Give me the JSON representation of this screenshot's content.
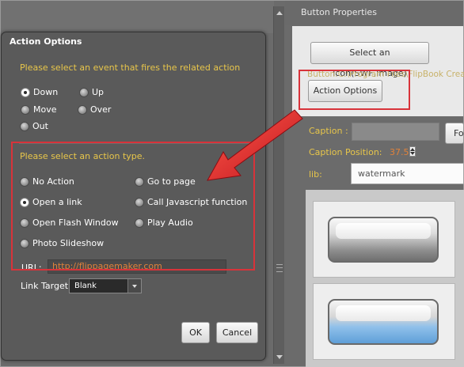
{
  "dialog": {
    "title": "Action Options",
    "event_prompt": "Please select an event that fires the related action",
    "events": [
      {
        "label": "Down",
        "checked": true
      },
      {
        "label": "Up",
        "checked": false
      },
      {
        "label": "Move",
        "checked": false
      },
      {
        "label": "Over",
        "checked": false
      },
      {
        "label": "Out",
        "checked": false
      }
    ],
    "action_prompt": "Please select an action type.",
    "actions": [
      {
        "label": "No Action",
        "checked": false
      },
      {
        "label": "Go to page",
        "checked": false
      },
      {
        "label": "Open a link",
        "checked": true
      },
      {
        "label": "Call Javascript function",
        "checked": false
      },
      {
        "label": "Open Flash Window",
        "checked": false
      },
      {
        "label": "Play Audio",
        "checked": false
      },
      {
        "label": "Photo Slideshow",
        "checked": false
      }
    ],
    "url_label": "URL:",
    "url_value": "http://flippagemaker.com",
    "link_target_label": "Link Target:",
    "link_target_value": "Blank",
    "ok_label": "OK",
    "cancel_label": "Cancel"
  },
  "properties": {
    "header": "Button Properties",
    "select_icon_label": "Select an Icon(SWF,Image)",
    "button_path": "Button:C:\\Program Files\\FlipBook Creator",
    "action_options_label": "Action Options",
    "caption_label": "Caption :",
    "caption_button": "Fo",
    "caption_position_label": "Caption Position:",
    "caption_position_value": "37.5",
    "lib_label": "lib:",
    "lib_value": "watermark"
  },
  "colors": {
    "accent_yellow": "#e8c64a",
    "accent_orange": "#e0823a",
    "highlight_red": "#d8333a",
    "panel_dark": "#5a5a5a"
  }
}
